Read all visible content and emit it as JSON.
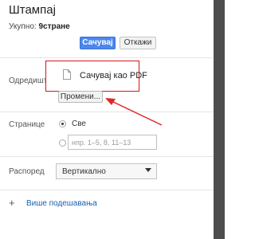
{
  "print": {
    "title": "Штампај",
    "total_label": "Укупно: ",
    "total_value": "9стране",
    "save_button": "Сачувај",
    "cancel_button": "Откажи"
  },
  "destination": {
    "label": "Одредиште",
    "value": "Сачувај као PDF",
    "change_button": "Промени..."
  },
  "pages": {
    "label": "Странице",
    "all_option": "Све",
    "range_placeholder": "нпр. 1–5, 8, 11–13",
    "selected": "all"
  },
  "layout": {
    "label": "Распоред",
    "selected_value": "Вертикално"
  },
  "more_settings": {
    "icon": "+",
    "label": "Више подешавања"
  },
  "colors": {
    "primary": "#4a87ee",
    "highlight": "#d9141c",
    "link": "#1a5fb4",
    "right_strip": "#4d4d4d"
  }
}
